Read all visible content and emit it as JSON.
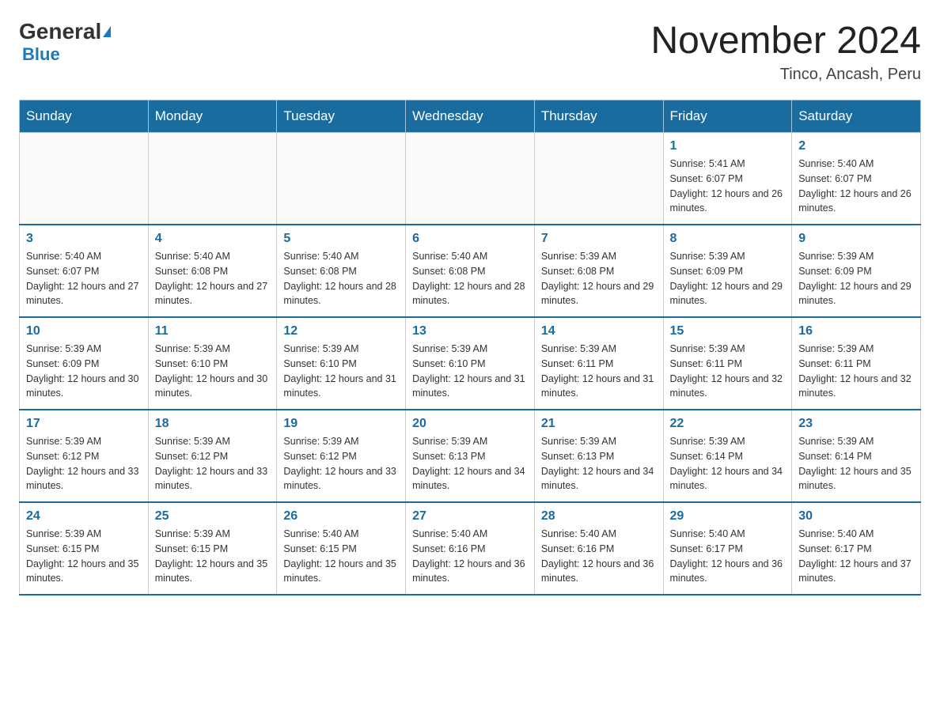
{
  "header": {
    "logo_general": "General",
    "logo_blue": "Blue",
    "month_title": "November 2024",
    "subtitle": "Tinco, Ancash, Peru"
  },
  "weekdays": [
    "Sunday",
    "Monday",
    "Tuesday",
    "Wednesday",
    "Thursday",
    "Friday",
    "Saturday"
  ],
  "weeks": [
    [
      {
        "day": "",
        "info": ""
      },
      {
        "day": "",
        "info": ""
      },
      {
        "day": "",
        "info": ""
      },
      {
        "day": "",
        "info": ""
      },
      {
        "day": "",
        "info": ""
      },
      {
        "day": "1",
        "info": "Sunrise: 5:41 AM\nSunset: 6:07 PM\nDaylight: 12 hours and 26 minutes."
      },
      {
        "day": "2",
        "info": "Sunrise: 5:40 AM\nSunset: 6:07 PM\nDaylight: 12 hours and 26 minutes."
      }
    ],
    [
      {
        "day": "3",
        "info": "Sunrise: 5:40 AM\nSunset: 6:07 PM\nDaylight: 12 hours and 27 minutes."
      },
      {
        "day": "4",
        "info": "Sunrise: 5:40 AM\nSunset: 6:08 PM\nDaylight: 12 hours and 27 minutes."
      },
      {
        "day": "5",
        "info": "Sunrise: 5:40 AM\nSunset: 6:08 PM\nDaylight: 12 hours and 28 minutes."
      },
      {
        "day": "6",
        "info": "Sunrise: 5:40 AM\nSunset: 6:08 PM\nDaylight: 12 hours and 28 minutes."
      },
      {
        "day": "7",
        "info": "Sunrise: 5:39 AM\nSunset: 6:08 PM\nDaylight: 12 hours and 29 minutes."
      },
      {
        "day": "8",
        "info": "Sunrise: 5:39 AM\nSunset: 6:09 PM\nDaylight: 12 hours and 29 minutes."
      },
      {
        "day": "9",
        "info": "Sunrise: 5:39 AM\nSunset: 6:09 PM\nDaylight: 12 hours and 29 minutes."
      }
    ],
    [
      {
        "day": "10",
        "info": "Sunrise: 5:39 AM\nSunset: 6:09 PM\nDaylight: 12 hours and 30 minutes."
      },
      {
        "day": "11",
        "info": "Sunrise: 5:39 AM\nSunset: 6:10 PM\nDaylight: 12 hours and 30 minutes."
      },
      {
        "day": "12",
        "info": "Sunrise: 5:39 AM\nSunset: 6:10 PM\nDaylight: 12 hours and 31 minutes."
      },
      {
        "day": "13",
        "info": "Sunrise: 5:39 AM\nSunset: 6:10 PM\nDaylight: 12 hours and 31 minutes."
      },
      {
        "day": "14",
        "info": "Sunrise: 5:39 AM\nSunset: 6:11 PM\nDaylight: 12 hours and 31 minutes."
      },
      {
        "day": "15",
        "info": "Sunrise: 5:39 AM\nSunset: 6:11 PM\nDaylight: 12 hours and 32 minutes."
      },
      {
        "day": "16",
        "info": "Sunrise: 5:39 AM\nSunset: 6:11 PM\nDaylight: 12 hours and 32 minutes."
      }
    ],
    [
      {
        "day": "17",
        "info": "Sunrise: 5:39 AM\nSunset: 6:12 PM\nDaylight: 12 hours and 33 minutes."
      },
      {
        "day": "18",
        "info": "Sunrise: 5:39 AM\nSunset: 6:12 PM\nDaylight: 12 hours and 33 minutes."
      },
      {
        "day": "19",
        "info": "Sunrise: 5:39 AM\nSunset: 6:12 PM\nDaylight: 12 hours and 33 minutes."
      },
      {
        "day": "20",
        "info": "Sunrise: 5:39 AM\nSunset: 6:13 PM\nDaylight: 12 hours and 34 minutes."
      },
      {
        "day": "21",
        "info": "Sunrise: 5:39 AM\nSunset: 6:13 PM\nDaylight: 12 hours and 34 minutes."
      },
      {
        "day": "22",
        "info": "Sunrise: 5:39 AM\nSunset: 6:14 PM\nDaylight: 12 hours and 34 minutes."
      },
      {
        "day": "23",
        "info": "Sunrise: 5:39 AM\nSunset: 6:14 PM\nDaylight: 12 hours and 35 minutes."
      }
    ],
    [
      {
        "day": "24",
        "info": "Sunrise: 5:39 AM\nSunset: 6:15 PM\nDaylight: 12 hours and 35 minutes."
      },
      {
        "day": "25",
        "info": "Sunrise: 5:39 AM\nSunset: 6:15 PM\nDaylight: 12 hours and 35 minutes."
      },
      {
        "day": "26",
        "info": "Sunrise: 5:40 AM\nSunset: 6:15 PM\nDaylight: 12 hours and 35 minutes."
      },
      {
        "day": "27",
        "info": "Sunrise: 5:40 AM\nSunset: 6:16 PM\nDaylight: 12 hours and 36 minutes."
      },
      {
        "day": "28",
        "info": "Sunrise: 5:40 AM\nSunset: 6:16 PM\nDaylight: 12 hours and 36 minutes."
      },
      {
        "day": "29",
        "info": "Sunrise: 5:40 AM\nSunset: 6:17 PM\nDaylight: 12 hours and 36 minutes."
      },
      {
        "day": "30",
        "info": "Sunrise: 5:40 AM\nSunset: 6:17 PM\nDaylight: 12 hours and 37 minutes."
      }
    ]
  ]
}
